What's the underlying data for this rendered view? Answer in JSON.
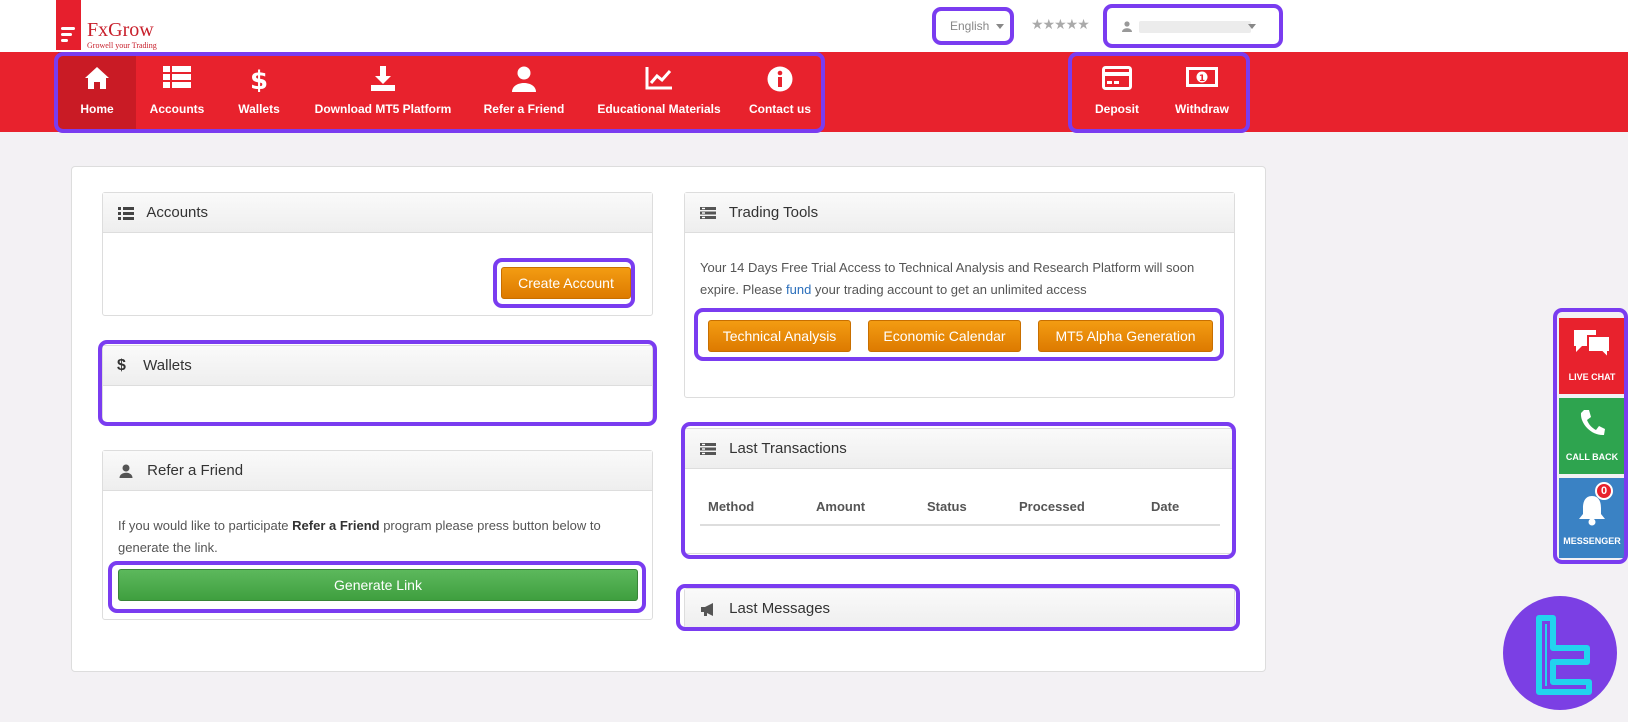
{
  "brand": {
    "name": "FxGrow",
    "tagline": "Growell your Trading"
  },
  "header": {
    "language": "English",
    "stars": "★★★★★"
  },
  "nav": {
    "items": [
      {
        "label": "Home",
        "icon": "home-icon"
      },
      {
        "label": "Accounts",
        "icon": "list-icon"
      },
      {
        "label": "Wallets",
        "icon": "dollar-icon"
      },
      {
        "label": "Download MT5 Platform",
        "icon": "download-icon"
      },
      {
        "label": "Refer a Friend",
        "icon": "user-icon"
      },
      {
        "label": "Educational Materials",
        "icon": "chart-icon"
      },
      {
        "label": "Contact us",
        "icon": "info-icon"
      }
    ],
    "deposit": "Deposit",
    "withdraw": "Withdraw"
  },
  "accounts": {
    "title": "Accounts",
    "create_button": "Create Account"
  },
  "wallets": {
    "title": "Wallets",
    "icon_glyph": "$"
  },
  "refer": {
    "title": "Refer a Friend",
    "text_before": "If you would like to participate ",
    "text_bold": "Refer a Friend",
    "text_after": " program please press button below to generate the link.",
    "button": "Generate Link"
  },
  "tools": {
    "title": "Trading Tools",
    "text_before": "Your 14 Days Free Trial Access to Technical Analysis and Research Platform will soon expire. Please ",
    "text_link": "fund",
    "text_after": " your trading account to get an unlimited access",
    "buttons": [
      "Technical Analysis",
      "Economic Calendar",
      "MT5 Alpha Generation"
    ]
  },
  "transactions": {
    "title": "Last Transactions",
    "columns": [
      "Method",
      "Amount",
      "Status",
      "Processed",
      "Date"
    ]
  },
  "messages": {
    "title": "Last Messages"
  },
  "side": {
    "live_chat": "LIVE CHAT",
    "call_back": "CALL BACK",
    "messenger": "MESSENGER",
    "messenger_count": "0"
  },
  "colors": {
    "brand_red": "#e8222d",
    "highlight": "#7a3cf0",
    "orange": "#f39c12",
    "green": "#5cb85c",
    "callback_green": "#2ea44f",
    "messenger_blue": "#3a82c4"
  }
}
